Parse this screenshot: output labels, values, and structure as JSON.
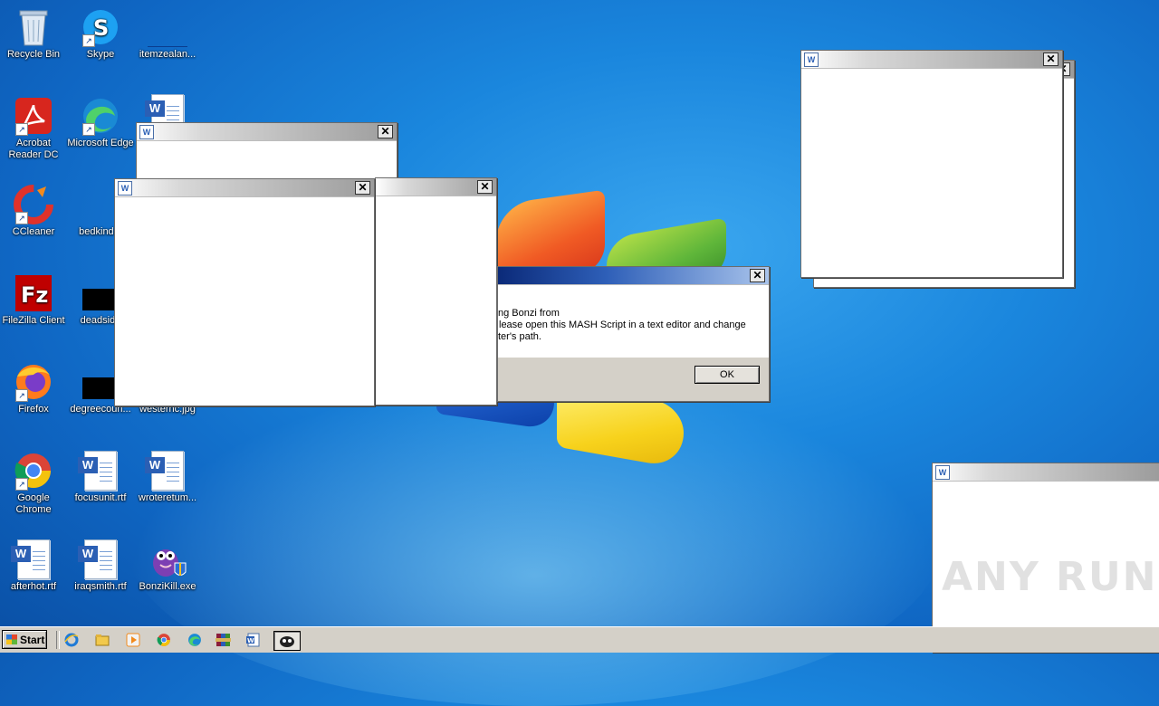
{
  "desktop_icons": [
    {
      "label": "Recycle Bin",
      "icon": "recycle-bin-icon"
    },
    {
      "label": "Skype",
      "icon": "skype-icon"
    },
    {
      "label": "itemzealan...",
      "icon": "blank-file-icon"
    },
    {
      "label": "Acrobat Reader DC",
      "icon": "acrobat-icon"
    },
    {
      "label": "Microsoft Edge",
      "icon": "edge-icon"
    },
    {
      "label": "CCleaner",
      "icon": "ccleaner-icon"
    },
    {
      "label": "bedkind.p",
      "icon": "blank-file-icon"
    },
    {
      "label": "FileZilla Client",
      "icon": "filezilla-icon"
    },
    {
      "label": "deadside",
      "icon": "black-file-icon"
    },
    {
      "label": "Firefox",
      "icon": "firefox-icon"
    },
    {
      "label": "degreecoun...",
      "icon": "black-file-icon"
    },
    {
      "label": "westernc.jpg",
      "icon": "image-file-icon"
    },
    {
      "label": "Google Chrome",
      "icon": "chrome-icon"
    },
    {
      "label": "focusunit.rtf",
      "icon": "word-doc-icon"
    },
    {
      "label": "wroteretum...",
      "icon": "word-doc-icon"
    },
    {
      "label": "afterhot.rtf",
      "icon": "word-doc-icon"
    },
    {
      "label": "iraqsmith.rtf",
      "icon": "word-doc-icon"
    },
    {
      "label": "BonziKill.exe",
      "icon": "bonzi-icon"
    }
  ],
  "dialog": {
    "line1": "ng Bonzi from",
    "line2": "lease open this MASH Script in a text editor and change",
    "line3": "ter's path.",
    "ok_label": "OK"
  },
  "window_glyphs": {
    "close": "✕",
    "app": "W"
  },
  "taskbar": {
    "start_label": "Start",
    "icons": [
      "ie-icon",
      "explorer-icon",
      "media-player-icon",
      "chrome-icon",
      "edge-icon",
      "winrar-icon",
      "word-icon",
      "bonzi-icon"
    ]
  },
  "watermark": "ANY RUN"
}
